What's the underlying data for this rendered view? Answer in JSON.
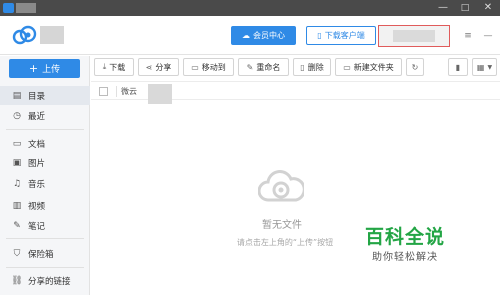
{
  "titlebar": {
    "minimize": "—",
    "maximize": "□",
    "close": "✕"
  },
  "header": {
    "vip_label": "会员中心",
    "download_client_label": "下载客户端",
    "menu_glyph": "≡",
    "minimize_glyph": "—"
  },
  "sidebar": {
    "upload_label": "上传",
    "items": [
      {
        "label": "目录",
        "icon": "grid-icon"
      },
      {
        "label": "最近",
        "icon": "clock-icon"
      },
      {
        "label": "文档",
        "icon": "document-icon"
      },
      {
        "label": "图片",
        "icon": "image-icon"
      },
      {
        "label": "音乐",
        "icon": "music-icon"
      },
      {
        "label": "视频",
        "icon": "video-icon"
      },
      {
        "label": "笔记",
        "icon": "note-icon"
      },
      {
        "label": "保险箱",
        "icon": "shield-icon"
      },
      {
        "label": "分享的链接",
        "icon": "link-icon"
      }
    ]
  },
  "toolbar": {
    "download": "下载",
    "share": "分享",
    "move_to": "移动到",
    "rename": "重命名",
    "delete": "删除",
    "new_folder": "新建文件夹"
  },
  "list": {
    "column_name": "微云"
  },
  "empty_state": {
    "title": "暂无文件",
    "hint": "请点击左上角的“上传”按钮"
  },
  "watermark": {
    "title": "百科全说",
    "subtitle": "助你轻松解决"
  },
  "colors": {
    "accent": "#2f8ae6",
    "titlebar": "#4a4a4a",
    "watermark_green": "#23a545"
  }
}
